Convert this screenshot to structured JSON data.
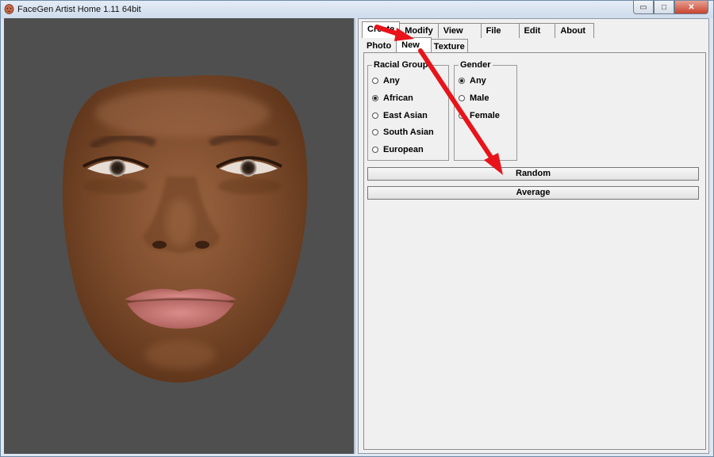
{
  "window": {
    "title": "FaceGen Artist Home 1.11 64bit",
    "controls": {
      "minimize": "▭",
      "maximize": "□",
      "close": "✕"
    }
  },
  "main_tabs": [
    {
      "label": "Create",
      "active": true
    },
    {
      "label": "Modify",
      "active": false
    },
    {
      "label": "View",
      "active": false
    },
    {
      "label": "File",
      "active": false
    },
    {
      "label": "Edit",
      "active": false
    },
    {
      "label": "About",
      "active": false
    }
  ],
  "sub_tabs": [
    {
      "label": "Photo",
      "active": false
    },
    {
      "label": "New",
      "active": true
    },
    {
      "label": "Texture",
      "active": false
    }
  ],
  "racial_group": {
    "title": "Racial Group",
    "options": [
      {
        "label": "Any",
        "checked": false
      },
      {
        "label": "African",
        "checked": true
      },
      {
        "label": "East Asian",
        "checked": false
      },
      {
        "label": "South Asian",
        "checked": false
      },
      {
        "label": "European",
        "checked": false
      }
    ]
  },
  "gender": {
    "title": "Gender",
    "options": [
      {
        "label": "Any",
        "checked": true
      },
      {
        "label": "Male",
        "checked": false
      },
      {
        "label": "Female",
        "checked": false
      }
    ]
  },
  "buttons": {
    "random": "Random",
    "average": "Average"
  },
  "colors": {
    "viewport_bg": "#4f4f4f",
    "annotation_arrow": "#e8141a",
    "skin": "#7a4b2e"
  },
  "icons": [
    "app-icon",
    "face-model",
    "annotation-arrow"
  ]
}
